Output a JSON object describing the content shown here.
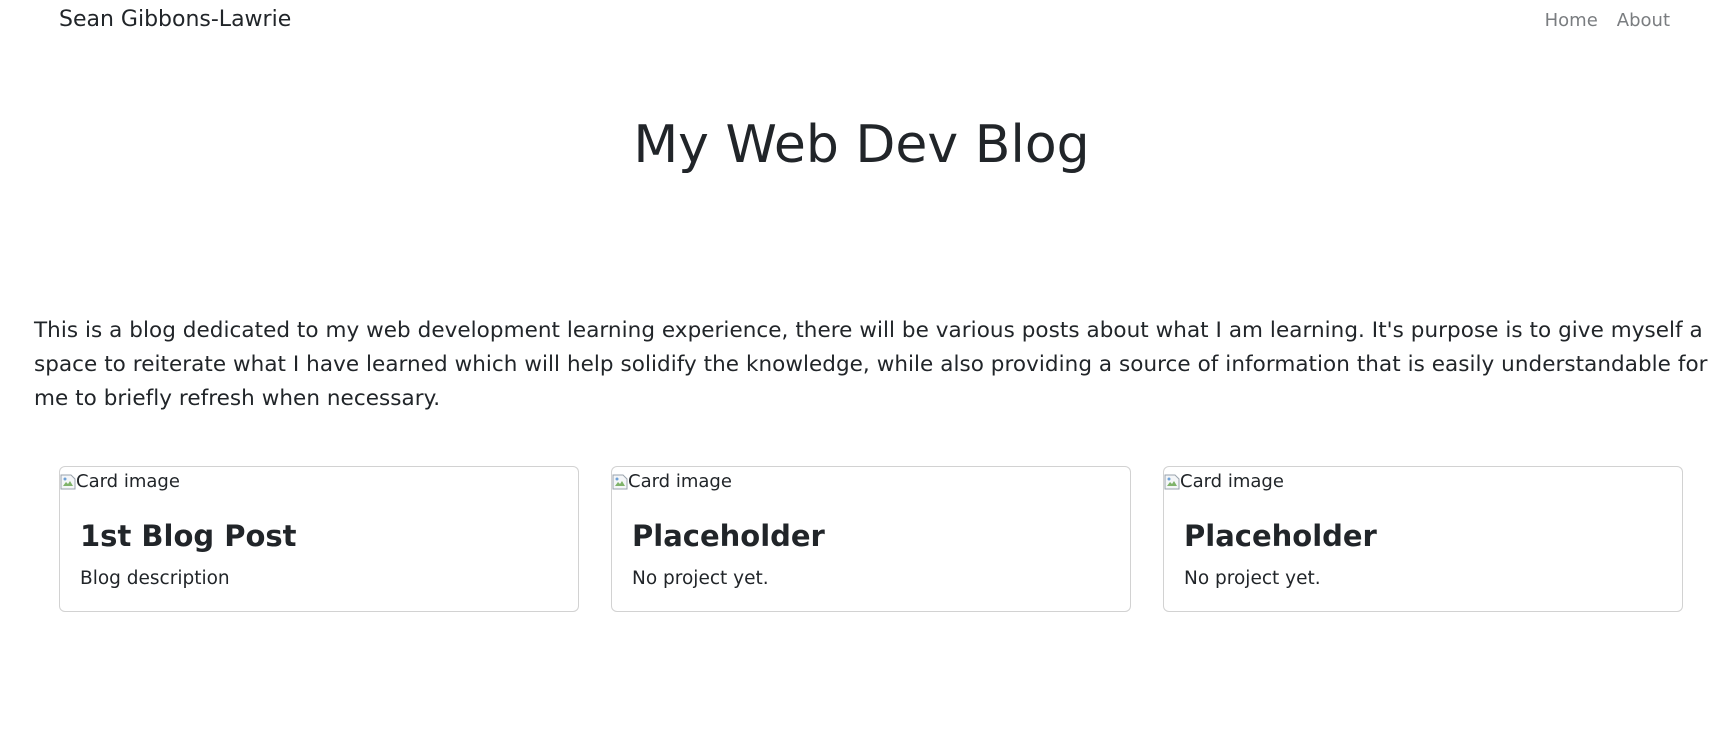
{
  "navbar": {
    "brand": "Sean Gibbons-Lawrie",
    "links": [
      {
        "label": "Home"
      },
      {
        "label": "About"
      }
    ]
  },
  "header": {
    "title": "My Web Dev Blog"
  },
  "intro": {
    "text": "This is a blog dedicated to my web development learning experience, there will be various posts about what I am learning. It's purpose is to give myself a space to reiterate what I have learned which will help solidify the knowledge, while also providing a source of information that is easily understandable for me to briefly refresh when necessary."
  },
  "cards": [
    {
      "image_alt": "Card image",
      "title": "1st Blog Post",
      "text": "Blog description"
    },
    {
      "image_alt": "Card image",
      "title": "Placeholder",
      "text": "No project yet."
    },
    {
      "image_alt": "Card image",
      "title": "Placeholder",
      "text": "No project yet."
    }
  ],
  "icons": {
    "broken_image": "broken-image-icon"
  }
}
